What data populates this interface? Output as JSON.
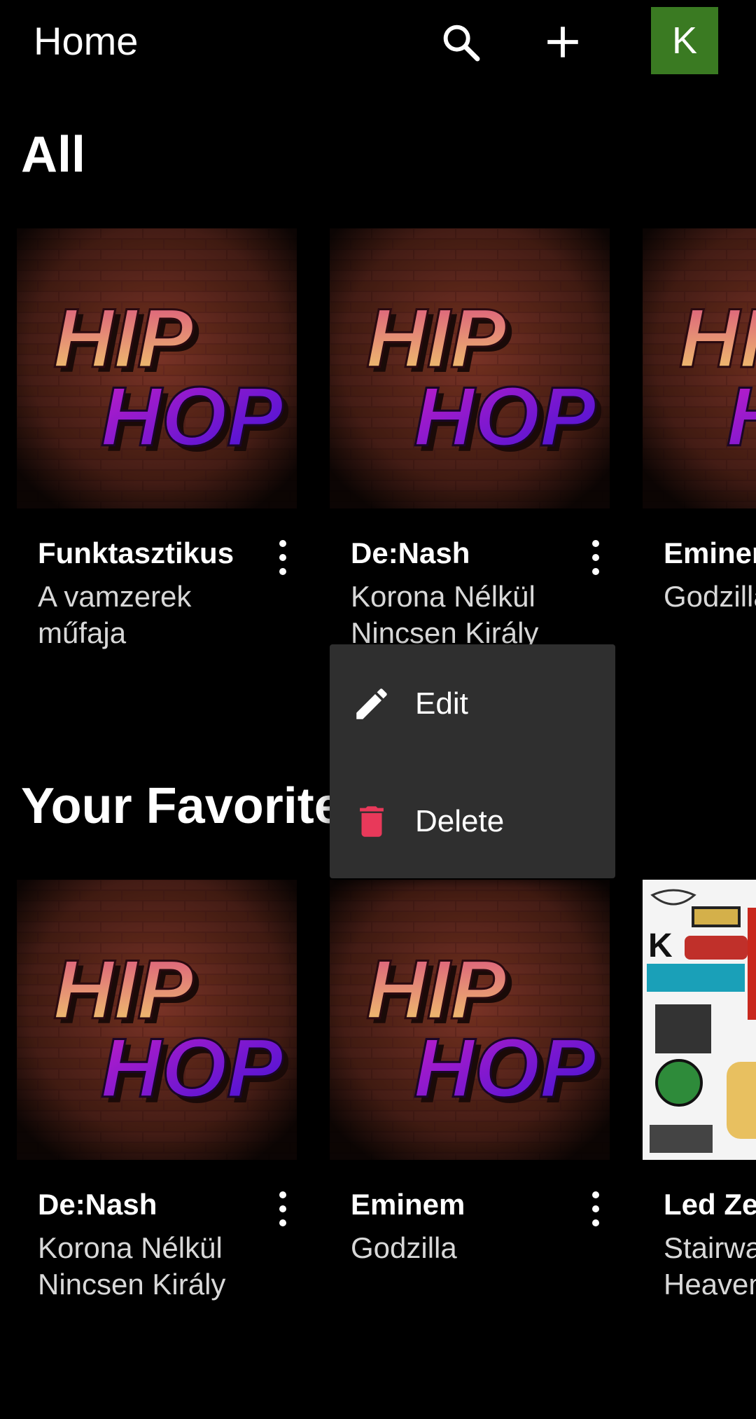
{
  "header": {
    "title": "Home",
    "avatar_letter": "K",
    "avatar_color": "#3a7a22"
  },
  "sections": {
    "all": {
      "title": "All",
      "cards": [
        {
          "title": "Funktasztikus",
          "subtitle": "A vamzerek műfaja",
          "cover": "hip-hop"
        },
        {
          "title": "De:Nash",
          "subtitle": "Korona Nélkül Nincsen Király",
          "cover": "hip-hop"
        },
        {
          "title": "Eminem",
          "subtitle": "Godzilla",
          "cover": "hip-hop"
        }
      ]
    },
    "favorites": {
      "title": "Your Favorites",
      "cards": [
        {
          "title": "De:Nash",
          "subtitle": "Korona Nélkül Nincsen Király",
          "cover": "hip-hop"
        },
        {
          "title": "Eminem",
          "subtitle": "Godzilla",
          "cover": "hip-hop"
        },
        {
          "title": "Led Zeppelin",
          "subtitle": "Stairway to Heaven",
          "cover": "rock-collage"
        }
      ]
    }
  },
  "context_menu": {
    "edit_label": "Edit",
    "delete_label": "Delete",
    "delete_color": "#e8395a"
  },
  "cover_art": {
    "line1": "HIP",
    "line2": "HOP"
  },
  "colors": {
    "background": "#000000",
    "menu_bg": "#2f2f2f",
    "subtitle": "#d8d8d8"
  },
  "icons": [
    "search-icon",
    "add-icon",
    "more-vert-icon",
    "pencil-icon",
    "trash-icon"
  ]
}
